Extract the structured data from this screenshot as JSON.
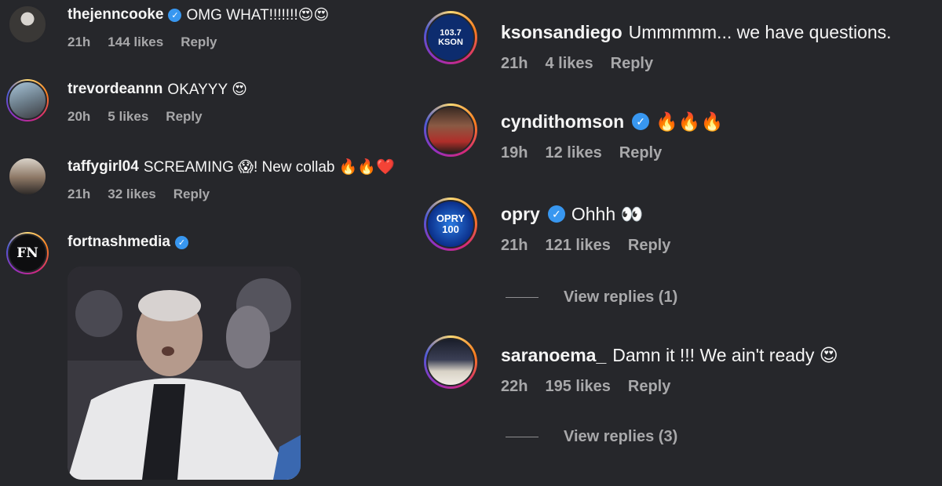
{
  "comments_left": [
    {
      "username": "thejenncooke",
      "verified": true,
      "text": "OMG WHAT!!!!!!!😍😍",
      "time": "21h",
      "likes": "144 likes",
      "reply": "Reply"
    },
    {
      "username": "trevordeannn",
      "verified": false,
      "text": "OKAYYY 😍",
      "time": "20h",
      "likes": "5 likes",
      "reply": "Reply"
    },
    {
      "username": "taffygirl04",
      "verified": false,
      "text": "SCREAMING 😱! New collab 🔥🔥❤️",
      "time": "21h",
      "likes": "32 likes",
      "reply": "Reply"
    },
    {
      "username": "fortnashmedia",
      "verified": true,
      "text": "",
      "avatar_text": "FN"
    }
  ],
  "comments_right": [
    {
      "username": "ksonsandiego",
      "verified": false,
      "text": "Ummmmm... we have questions.",
      "time": "21h",
      "likes": "4 likes",
      "reply": "Reply",
      "avatar_text": "103.7 KSON"
    },
    {
      "username": "cyndithomson",
      "verified": true,
      "text": "🔥🔥🔥",
      "time": "19h",
      "likes": "12 likes",
      "reply": "Reply"
    },
    {
      "username": "opry",
      "verified": true,
      "text": "Ohhh 👀",
      "time": "21h",
      "likes": "121 likes",
      "reply": "Reply",
      "avatar_text": "OPRY 100"
    },
    {
      "username": "saranoema_",
      "verified": false,
      "text": "Damn it !!! We ain't ready 😍",
      "time": "22h",
      "likes": "195 likes",
      "reply": "Reply"
    }
  ],
  "view_replies": [
    "View replies (1)",
    "View replies (3)"
  ],
  "icons": {
    "verified": "verified-badge-icon"
  },
  "colors": {
    "background": "#26272b",
    "verified": "#3897f0",
    "meta": "#a8a8aa"
  }
}
